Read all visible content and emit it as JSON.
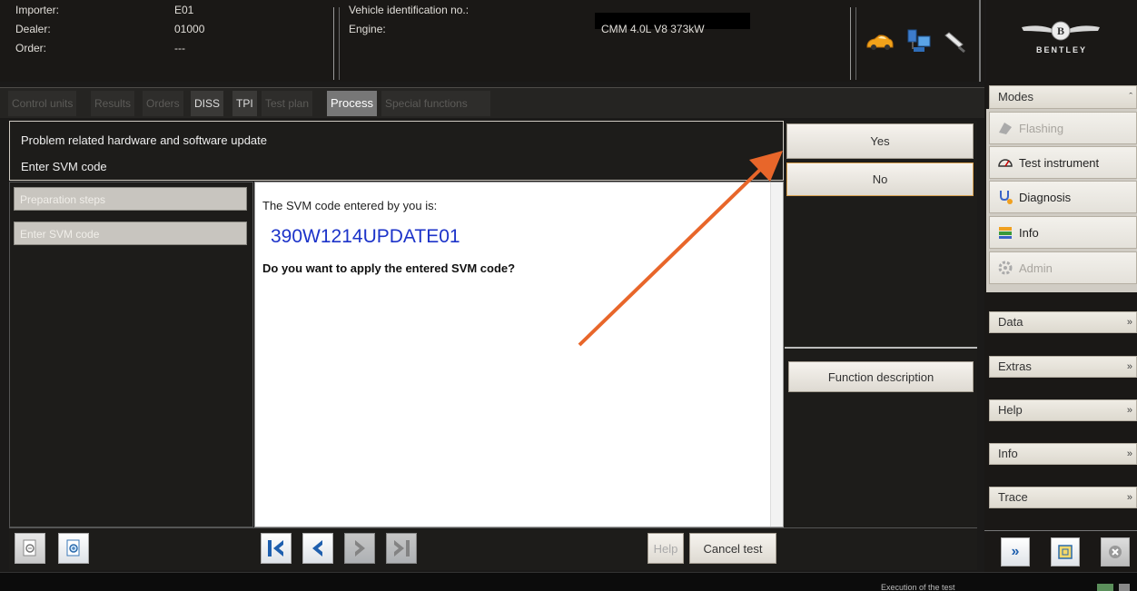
{
  "header": {
    "importer_label": "Importer:",
    "importer_value": "E01",
    "dealer_label": "Dealer:",
    "dealer_value": "01000",
    "order_label": "Order:",
    "order_value": "---",
    "vin_label": "Vehicle identification no.:",
    "engine_label": "Engine:",
    "engine_value": "CMM 4.0L V8  373kW",
    "brand": "BENTLEY",
    "icons": [
      "car-icon",
      "network-icon",
      "probe-icon"
    ]
  },
  "tabs": [
    {
      "label": "Control units",
      "state": "inactive"
    },
    {
      "label": "Results",
      "state": "inactive"
    },
    {
      "label": "Orders",
      "state": "inactive"
    },
    {
      "label": "DISS",
      "state": "enabled"
    },
    {
      "label": "TPI",
      "state": "enabled"
    },
    {
      "label": "Test plan",
      "state": "inactive"
    },
    {
      "label": "Process",
      "state": "active"
    },
    {
      "label": "Special functions",
      "state": "inactive"
    }
  ],
  "process": {
    "title": "Problem related hardware and software update",
    "subtitle": "Enter SVM code",
    "steps": [
      "Preparation steps",
      "Enter SVM code"
    ],
    "message": "The SVM code entered by you is:",
    "svm_code": "390W1214UPDATE01",
    "question": "Do you want to apply the entered SVM code?"
  },
  "actions": {
    "yes": "Yes",
    "no": "No",
    "function_description": "Function description"
  },
  "bottom": {
    "help": "Help",
    "cancel": "Cancel test"
  },
  "sidebar": {
    "modes_title": "Modes",
    "modes": [
      {
        "label": "Flashing",
        "enabled": false,
        "icon": "flash-icon"
      },
      {
        "label": "Test instrument",
        "enabled": true,
        "icon": "gauge-icon"
      },
      {
        "label": "Diagnosis",
        "enabled": true,
        "icon": "stethoscope-icon"
      },
      {
        "label": "Info",
        "enabled": true,
        "icon": "books-icon"
      },
      {
        "label": "Admin",
        "enabled": false,
        "icon": "gear-icon"
      }
    ],
    "sections": [
      "Data",
      "Extras",
      "Help",
      "Info",
      "Trace"
    ]
  },
  "status": {
    "text": "Execution of the test"
  },
  "colors": {
    "svm_code": "#1c33c9",
    "arrow": "#e8662a",
    "nav_blue": "#1e5fae"
  }
}
